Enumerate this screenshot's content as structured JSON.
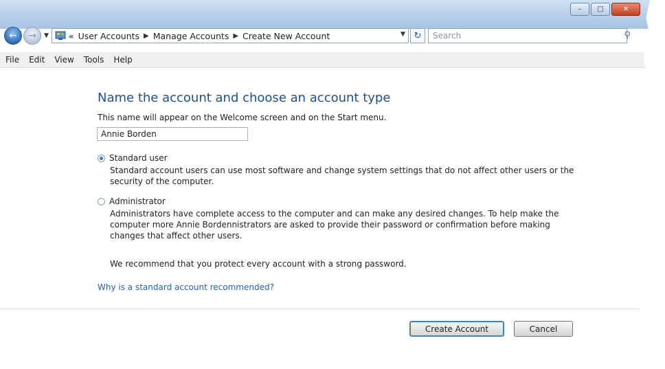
{
  "window": {
    "caption_buttons": [
      "minimize-icon",
      "maximize-icon",
      "close-icon"
    ]
  },
  "navigation": {
    "back_icon": "back-arrow-icon",
    "forward_icon": "forward-arrow-icon",
    "breadcrumbs": [
      "User Accounts",
      "Manage Accounts",
      "Create New Account"
    ],
    "overflow": "«",
    "search_placeholder": "Search"
  },
  "menu": {
    "items": [
      "File",
      "Edit",
      "View",
      "Tools",
      "Help"
    ]
  },
  "page": {
    "heading": "Name the account and choose an account type",
    "prompt": "This name will appear on the Welcome screen and on the Start menu.",
    "account_name": "Annie Borden",
    "options": [
      {
        "label": "Standard user",
        "selected": true,
        "description": "Standard account users can use most software and change system settings that do not affect other users or the security of the computer."
      },
      {
        "label": "Administrator",
        "selected": false,
        "description": "Administrators have complete access to the computer and can make any desired changes. To help make the computer more Annie Bordennistrators are asked to provide their password or confirmation before making changes that affect other users."
      }
    ],
    "recommendation": "We recommend that you protect every account with a strong password.",
    "help_link": "Why is a standard account recommended?"
  },
  "footer": {
    "create_label": "Create Account",
    "cancel_label": "Cancel"
  },
  "colors": {
    "heading": "#1f4f8a",
    "link": "#2463b5",
    "titlebar": "#b9d0ea"
  }
}
